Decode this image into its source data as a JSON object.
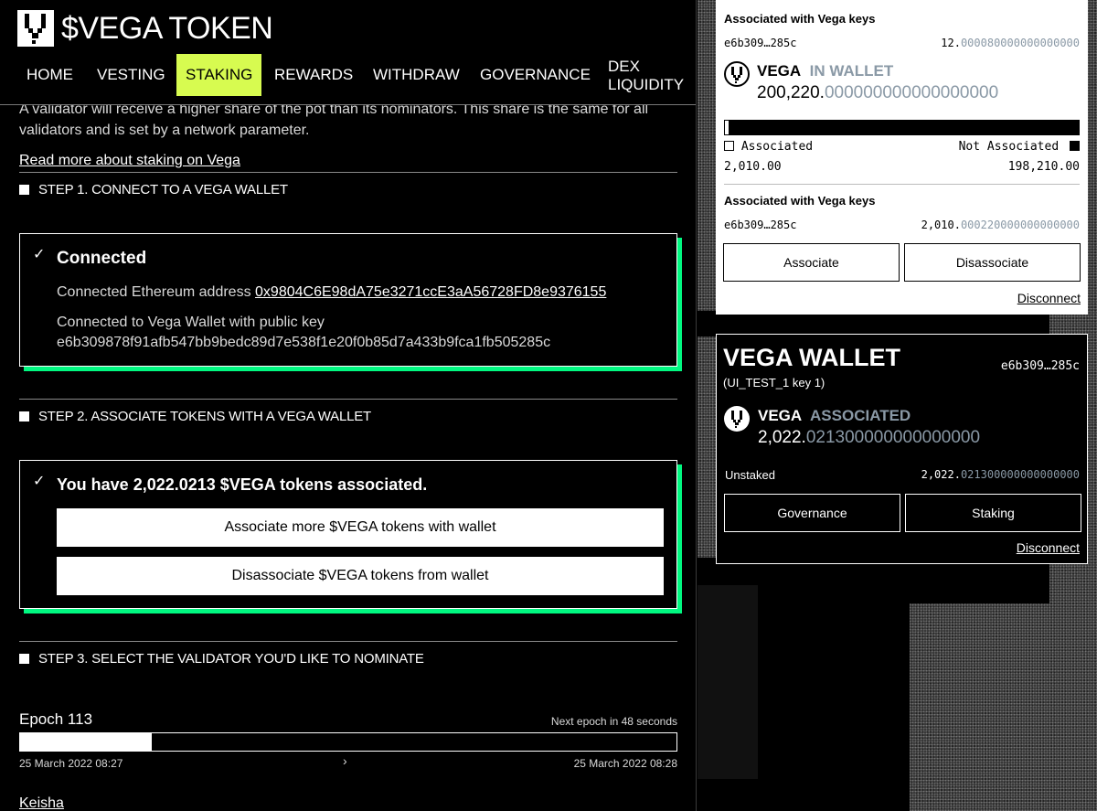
{
  "header": {
    "brand": "$VEGA TOKEN",
    "nav": [
      {
        "label": "HOME"
      },
      {
        "label": "VESTING"
      },
      {
        "label": "STAKING"
      },
      {
        "label": "REWARDS"
      },
      {
        "label": "WITHDRAW"
      },
      {
        "label": "GOVERNANCE"
      },
      {
        "label_line1": "DEX",
        "label_line2": "LIQUIDITY"
      }
    ],
    "active_nav": "STAKING"
  },
  "main": {
    "intro_text": "A validator will receive a higher share of the pot than its nominators. This share is the same for all validators and is set by a network parameter.",
    "read_more": "Read more about staking on Vega",
    "step1": {
      "label": "STEP 1. CONNECT TO A VEGA WALLET",
      "card_title": "Connected",
      "eth_prefix": "Connected Ethereum address",
      "eth_address": "0x9804C6E98dA75e3271ccE3aA56728FD8e9376155",
      "vega_prefix": "Connected to Vega Wallet with public key",
      "vega_key": "e6b309878f91afb547bb9bedc89d7e538f1e20f0b85d7a433b9fca1fb505285c"
    },
    "step2": {
      "label": "STEP 2. ASSOCIATE TOKENS WITH A VEGA WALLET",
      "card_title": "You have 2,022.0213 $VEGA tokens associated.",
      "associate_button": "Associate more $VEGA tokens with wallet",
      "disassociate_button": "Disassociate $VEGA tokens from wallet"
    },
    "step3": {
      "label": "STEP 3. SELECT THE VALIDATOR YOU'D LIKE TO NOMINATE"
    },
    "epoch": {
      "label": "Epoch 113",
      "next": "Next epoch in 48 seconds",
      "progress": 0.2,
      "start": "25 March 2022 08:27",
      "end": "25 March 2022 08:28"
    },
    "validator_link": "Keisha"
  },
  "eth_wallet": {
    "assoc_heading_top": "Associated with Vega keys",
    "top_key": "e6b309…285c",
    "top_amount_main": "12.",
    "top_amount_dim": "000080000000000000",
    "token": "VEGA",
    "token_status": "IN WALLET",
    "balance_main": "200,220.",
    "balance_dim": "000000000000000000",
    "associated_share": 0.01,
    "legend_associated": "Associated",
    "legend_not_associated": "Not Associated",
    "associated_value": "2,010.00",
    "not_associated_value": "198,210.00",
    "assoc_heading": "Associated with Vega keys",
    "key": "e6b309…285c",
    "key_amount_main": "2,010.",
    "key_amount_dim": "000220000000000000",
    "associate_button": "Associate",
    "disassociate_button": "Disassociate",
    "disconnect": "Disconnect"
  },
  "vega_wallet": {
    "title": "VEGA WALLET",
    "key_short": "e6b309…285c",
    "key_name": "(UI_TEST_1 key 1)",
    "token": "VEGA",
    "token_status": "ASSOCIATED",
    "balance_main": "2,022.",
    "balance_dim": "021300000000000000",
    "unstaked_label": "Unstaked",
    "unstaked_main": "2,022.",
    "unstaked_dim": "021300000000000000",
    "governance_button": "Governance",
    "staking_button": "Staking",
    "disconnect": "Disconnect"
  },
  "colors": {
    "accent_green": "#00f780",
    "active_nav": "#d7fb50",
    "muted_digits": "#8a99a6"
  }
}
